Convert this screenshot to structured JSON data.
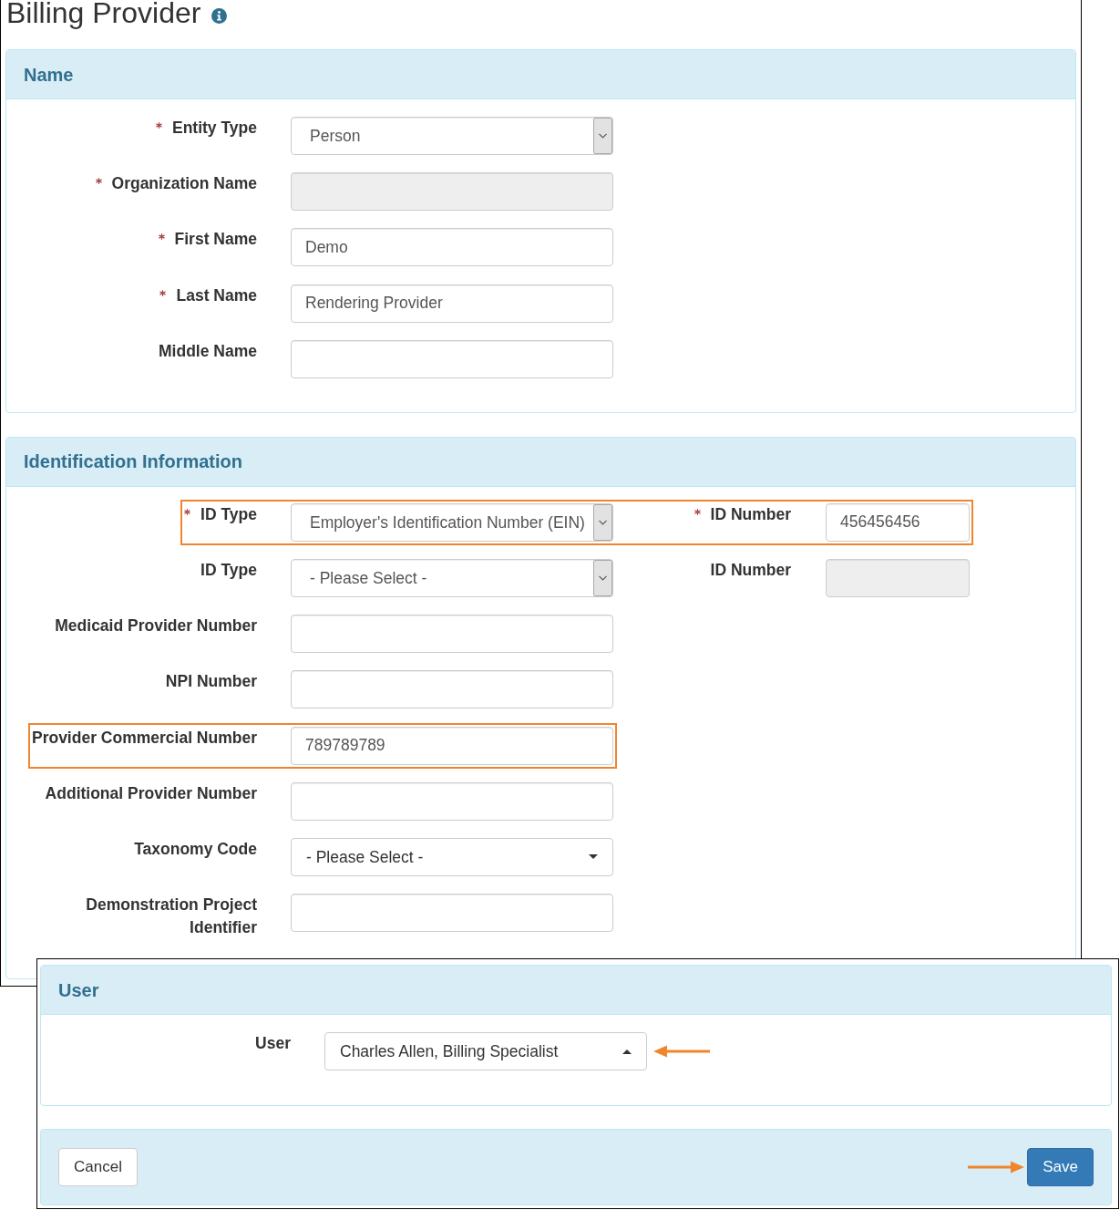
{
  "page": {
    "title": "Billing Provider"
  },
  "panels": [
    {
      "title": "Name",
      "rows": [
        {
          "highlighted": false,
          "field": {
            "kind": "select",
            "label": "Entity Type",
            "required": true,
            "value": "Person"
          }
        },
        {
          "highlighted": false,
          "field": {
            "kind": "text",
            "label": "Organization Name",
            "required": true,
            "disabled": true
          }
        },
        {
          "highlighted": false,
          "field": {
            "kind": "text",
            "label": "First Name",
            "required": true,
            "disabled": false,
            "value": "Demo"
          }
        },
        {
          "highlighted": false,
          "field": {
            "kind": "text",
            "label": "Last Name",
            "required": true,
            "disabled": false,
            "value": "Rendering Provider"
          }
        },
        {
          "highlighted": false,
          "field": {
            "kind": "text",
            "label": "Middle Name",
            "required": false,
            "disabled": false
          }
        }
      ]
    },
    {
      "title": "Identification Information",
      "rows": [
        {
          "highlighted": true,
          "field": {
            "kind": "select",
            "label": "ID Type",
            "required": true,
            "value": "Employer's Identification Number (EIN)"
          },
          "side_field": {
            "kind": "text",
            "label": "ID Number",
            "required": true,
            "disabled": false,
            "value": "456456456"
          }
        },
        {
          "highlighted": false,
          "field": {
            "kind": "select",
            "label": "ID Type",
            "required": false,
            "value": "- Please Select -"
          },
          "side_field": {
            "kind": "text",
            "label": "ID Number",
            "required": false,
            "disabled": true
          }
        },
        {
          "highlighted": false,
          "field": {
            "kind": "text",
            "label": "Medicaid Provider Number",
            "required": false,
            "disabled": false
          }
        },
        {
          "highlighted": false,
          "field": {
            "kind": "text",
            "label": "NPI Number",
            "required": false,
            "disabled": false
          }
        },
        {
          "highlighted": true,
          "field": {
            "kind": "text",
            "label": "Provider Commercial Number",
            "required": false,
            "disabled": false,
            "value": "789789789"
          }
        },
        {
          "highlighted": false,
          "field": {
            "kind": "text",
            "label": "Additional Provider Number",
            "required": false,
            "disabled": false
          }
        },
        {
          "highlighted": false,
          "field": {
            "kind": "dropdown",
            "label": "Taxonomy Code",
            "required": false,
            "expanded": false,
            "value": "- Please Select -"
          }
        },
        {
          "highlighted": false,
          "field": {
            "kind": "text",
            "label": "Demonstration Project Identifier",
            "required": false,
            "disabled": false
          }
        }
      ]
    }
  ],
  "user_panel": {
    "title": "User",
    "rows": [
      {
        "highlighted": false,
        "pointer_arrow": true,
        "field": {
          "kind": "dropdown",
          "label": "User",
          "required": false,
          "expanded": true,
          "value": "Charles Allen, Billing Specialist"
        }
      }
    ]
  },
  "footer": {
    "buttons": [
      {
        "kind": "secondary",
        "label": "Cancel",
        "pointer_arrow": false
      },
      {
        "kind": "primary",
        "label": "Save",
        "pointer_arrow": true
      }
    ]
  }
}
